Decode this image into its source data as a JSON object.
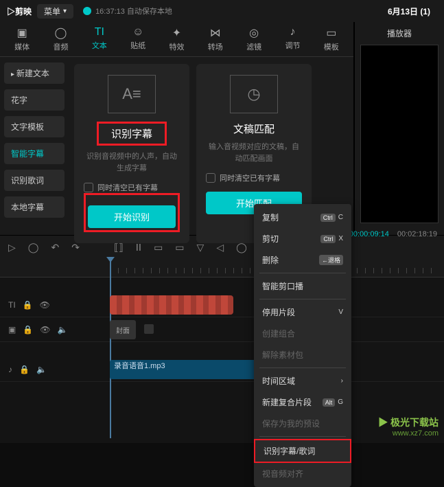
{
  "topbar": {
    "logo": "▷剪映",
    "menu": "菜单",
    "autosave": "16:37:13 自动保存本地",
    "date_title": "6月13日 (1)"
  },
  "tabs": [
    {
      "icon": "▣",
      "label": "媒体"
    },
    {
      "icon": "◯",
      "label": "音频"
    },
    {
      "icon": "TI",
      "label": "文本"
    },
    {
      "icon": "☺",
      "label": "贴纸"
    },
    {
      "icon": "✦",
      "label": "特效"
    },
    {
      "icon": "⋈",
      "label": "转场"
    },
    {
      "icon": "◎",
      "label": "滤镜"
    },
    {
      "icon": "♪",
      "label": "调节"
    },
    {
      "icon": "▭",
      "label": "模板"
    }
  ],
  "sidebar": [
    {
      "label": "新建文本",
      "arrow": true
    },
    {
      "label": "花字"
    },
    {
      "label": "文字模板"
    },
    {
      "label": "智能字幕",
      "active": true
    },
    {
      "label": "识别歌词"
    },
    {
      "label": "本地字幕"
    }
  ],
  "cards": {
    "left": {
      "icon_text": "A≡",
      "title": "识别字幕",
      "desc": "识别音视频中的人声，自动生成字幕",
      "checkbox": "同时清空已有字幕",
      "button": "开始识别"
    },
    "right": {
      "icon_text": "◷",
      "title": "文稿匹配",
      "desc": "输入音视频对应的文稿，自动匹配画面",
      "checkbox": "同时清空已有字幕",
      "button": "开始匹配"
    }
  },
  "player": {
    "title": "播放器"
  },
  "time": {
    "current": "00:00:09:14",
    "total": "00:02:18:19"
  },
  "toolbar_icons": [
    "▷",
    "◯",
    "↶",
    "↷",
    "⟦⟧",
    "ⅠⅠ",
    "▭",
    "▭",
    "▽",
    "◁",
    "◯"
  ],
  "tracks": {
    "text": {
      "icon": "TI"
    },
    "video": {
      "cover_label": "封面"
    },
    "audio": {
      "clip_name": "录音语音1.mp3"
    }
  },
  "context_menu": [
    {
      "label": "复制",
      "key_badge": "Ctrl",
      "key": "C"
    },
    {
      "label": "剪切",
      "key_badge": "Ctrl",
      "key": "X"
    },
    {
      "label": "删除",
      "key_badge": "←退格"
    },
    {
      "sep": true
    },
    {
      "label": "智能剪口播"
    },
    {
      "sep": true
    },
    {
      "label": "停用片段",
      "key": "V"
    },
    {
      "label": "创建组合",
      "disabled": true
    },
    {
      "label": "解除素材包",
      "disabled": true
    },
    {
      "sep": true
    },
    {
      "label": "时间区域",
      "arrow": true
    },
    {
      "label": "新建复合片段",
      "key_badge": "Alt",
      "key": "G"
    },
    {
      "label": "保存为我的预设",
      "disabled": true
    },
    {
      "sep": true
    },
    {
      "label": "识别字幕/歌词",
      "highlight": true
    },
    {
      "label": "视音频对齐",
      "disabled": true
    }
  ],
  "watermark": {
    "line1": "▶ 极光下载站",
    "line2": "www.xz7.com"
  }
}
